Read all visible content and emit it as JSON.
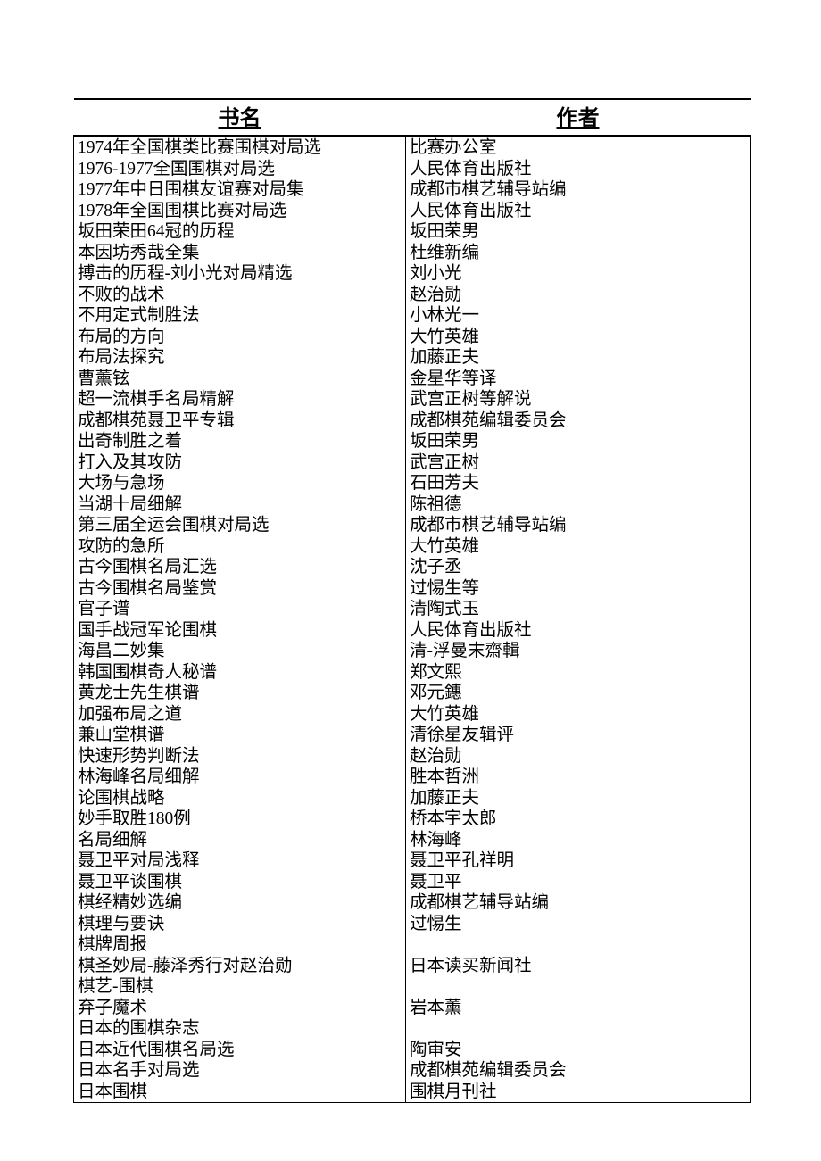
{
  "headers": {
    "book": "书名",
    "author": "作者"
  },
  "rows": [
    {
      "book": "1974年全国棋类比赛围棋对局选",
      "author": "比赛办公室"
    },
    {
      "book": "1976-1977全国围棋对局选",
      "author": "人民体育出版社"
    },
    {
      "book": "1977年中日围棋友谊赛对局集",
      "author": "成都市棋艺辅导站编"
    },
    {
      "book": "1978年全国围棋比赛对局选",
      "author": "人民体育出版社"
    },
    {
      "book": "坂田荣田64冠的历程",
      "author": "坂田荣男"
    },
    {
      "book": "本因坊秀哉全集",
      "author": "杜维新编"
    },
    {
      "book": "搏击的历程-刘小光对局精选",
      "author": "刘小光"
    },
    {
      "book": "不败的战术",
      "author": "赵治勋"
    },
    {
      "book": "不用定式制胜法",
      "author": "小林光一"
    },
    {
      "book": "布局的方向",
      "author": "大竹英雄"
    },
    {
      "book": "布局法探究",
      "author": "加藤正夫"
    },
    {
      "book": "曹薰铉",
      "author": "金星华等译"
    },
    {
      "book": "超一流棋手名局精解",
      "author": "武宫正树等解说"
    },
    {
      "book": "成都棋苑聂卫平专辑",
      "author": "成都棋苑编辑委员会"
    },
    {
      "book": "出奇制胜之着",
      "author": "坂田荣男"
    },
    {
      "book": "打入及其攻防",
      "author": "武宫正树"
    },
    {
      "book": "大场与急场",
      "author": "石田芳夫"
    },
    {
      "book": "当湖十局细解",
      "author": "陈祖德"
    },
    {
      "book": "第三届全运会围棋对局选",
      "author": "成都市棋艺辅导站编"
    },
    {
      "book": "攻防的急所",
      "author": "大竹英雄"
    },
    {
      "book": "古今围棋名局汇选",
      "author": "沈子丞"
    },
    {
      "book": "古今围棋名局鉴赏",
      "author": "过惕生等"
    },
    {
      "book": "官子谱",
      "author": "清陶式玉"
    },
    {
      "book": "国手战冠军论围棋",
      "author": "人民体育出版社"
    },
    {
      "book": "海昌二妙集",
      "author": "清-浮曼末齋輯"
    },
    {
      "book": "韩国围棋奇人秘谱",
      "author": "郑文熙"
    },
    {
      "book": "黄龙士先生棋谱",
      "author": "邓元鏸"
    },
    {
      "book": "加强布局之道",
      "author": "大竹英雄"
    },
    {
      "book": "兼山堂棋谱",
      "author": "清徐星友辑评"
    },
    {
      "book": "快速形势判断法",
      "author": "赵治勋"
    },
    {
      "book": "林海峰名局细解",
      "author": "胜本哲洲"
    },
    {
      "book": "论围棋战略",
      "author": "加藤正夫"
    },
    {
      "book": "妙手取胜180例",
      "author": "桥本宇太郎"
    },
    {
      "book": "名局细解",
      "author": "林海峰"
    },
    {
      "book": "聂卫平对局浅释",
      "author": "聂卫平孔祥明"
    },
    {
      "book": "聂卫平谈围棋",
      "author": "聂卫平"
    },
    {
      "book": "棋经精妙选编",
      "author": "成都棋艺辅导站编"
    },
    {
      "book": "棋理与要诀",
      "author": "过惕生"
    },
    {
      "book": "棋牌周报",
      "author": ""
    },
    {
      "book": "棋圣妙局-藤泽秀行对赵治勋",
      "author": "日本读买新闻社"
    },
    {
      "book": "棋艺-围棋",
      "author": ""
    },
    {
      "book": "弃子魔术",
      "author": "岩本薰"
    },
    {
      "book": "日本的围棋杂志",
      "author": ""
    },
    {
      "book": "日本近代围棋名局选",
      "author": "陶审安"
    },
    {
      "book": "日本名手对局选",
      "author": "成都棋苑编辑委员会"
    },
    {
      "book": "日本围棋",
      "author": "围棋月刊社"
    }
  ]
}
